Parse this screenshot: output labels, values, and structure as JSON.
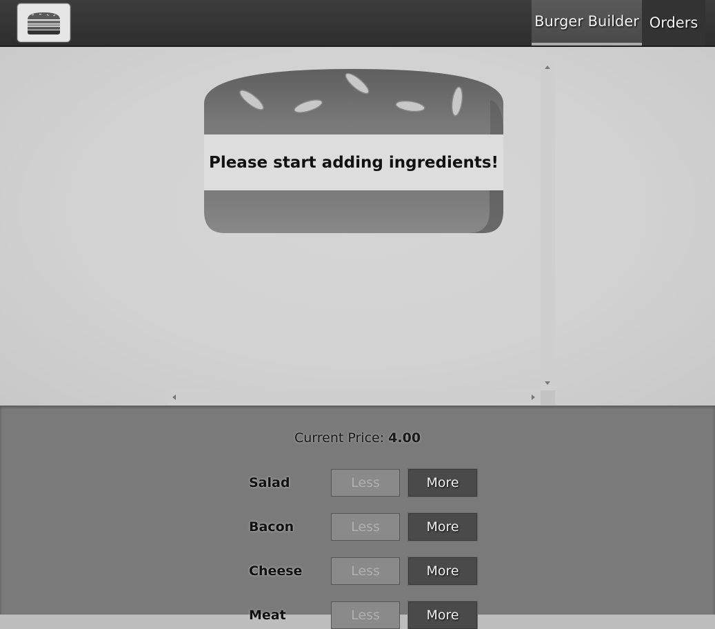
{
  "toolbar": {
    "nav": [
      {
        "label": "Burger Builder",
        "active": true
      },
      {
        "label": "Orders",
        "active": false
      }
    ]
  },
  "burger": {
    "message": "Please start adding ingredients!"
  },
  "controls": {
    "price_label": "Current Price:",
    "price_value": "4.00",
    "items": [
      {
        "label": "Salad",
        "less": "Less",
        "more": "More"
      },
      {
        "label": "Bacon",
        "less": "Less",
        "more": "More"
      },
      {
        "label": "Cheese",
        "less": "Less",
        "more": "More"
      },
      {
        "label": "Meat",
        "less": "Less",
        "more": "More"
      }
    ]
  }
}
